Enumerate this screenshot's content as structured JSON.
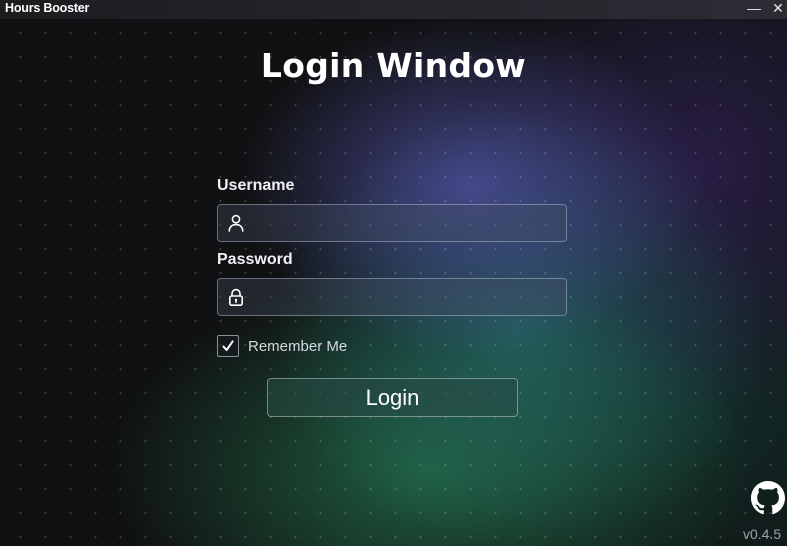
{
  "window": {
    "title": "Hours Booster",
    "minimize_label": "—",
    "close_label": "✕"
  },
  "login": {
    "heading": "Login Window",
    "username_label": "Username",
    "username_value": "",
    "password_label": "Password",
    "password_value": "",
    "remember_label": "Remember Me",
    "remember_checked": true,
    "login_button": "Login"
  },
  "footer": {
    "github_icon": "github-icon",
    "version": "v0.4.5"
  },
  "icons": {
    "username": "user-icon",
    "password": "lock-icon",
    "checkbox": "checkmark-icon"
  },
  "colors": {
    "background": "#101112",
    "glow_blue": "#5254aa",
    "glow_teal": "#287878",
    "glow_green": "#24784e",
    "text": "#ffffff"
  }
}
